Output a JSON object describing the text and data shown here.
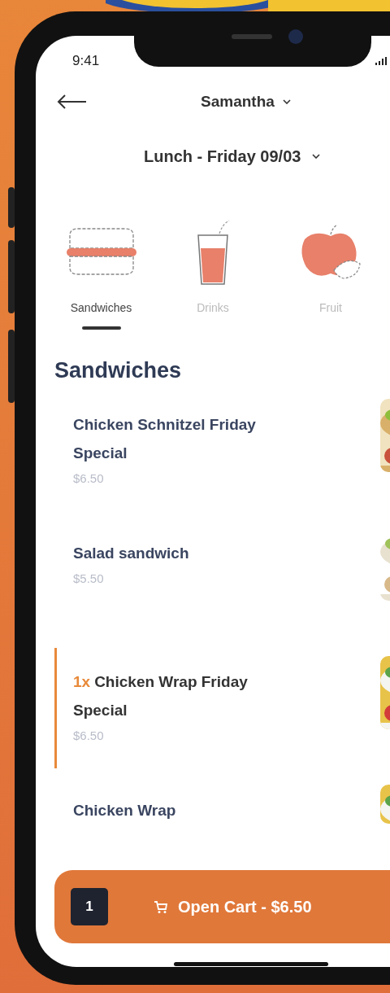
{
  "status_bar": {
    "time": "9:41"
  },
  "header": {
    "child": "Samantha",
    "meal": "Lunch - Friday 09/03"
  },
  "categories": [
    {
      "label": "Sandwiches",
      "selected": true,
      "kind": "sandwich"
    },
    {
      "label": "Drinks",
      "selected": false,
      "kind": "drink"
    },
    {
      "label": "Fruit",
      "selected": false,
      "kind": "fruit"
    }
  ],
  "section_title": "Sandwiches",
  "items": [
    {
      "name": "Chicken Schnitzel Friday Special",
      "price": "$6.50",
      "in_cart": false
    },
    {
      "name": "Salad sandwich",
      "price": "$5.50",
      "in_cart": false
    },
    {
      "quantity": "1x",
      "name": "Chicken Wrap Friday Special",
      "price": "$6.50",
      "in_cart": true
    },
    {
      "name": "Chicken Wrap",
      "in_cart": false
    }
  ],
  "cart": {
    "count": "1",
    "label": "Open Cart - $6.50"
  }
}
